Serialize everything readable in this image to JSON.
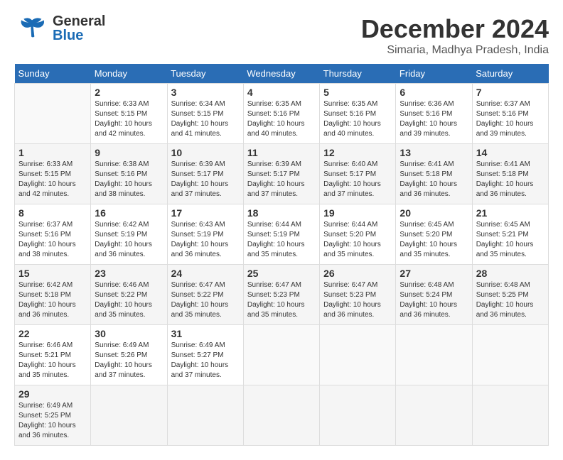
{
  "header": {
    "logo_general": "General",
    "logo_blue": "Blue",
    "month_title": "December 2024",
    "location": "Simaria, Madhya Pradesh, India"
  },
  "calendar": {
    "days_of_week": [
      "Sunday",
      "Monday",
      "Tuesday",
      "Wednesday",
      "Thursday",
      "Friday",
      "Saturday"
    ],
    "weeks": [
      [
        {
          "day": "",
          "info": ""
        },
        {
          "day": "2",
          "info": "Sunrise: 6:33 AM\nSunset: 5:15 PM\nDaylight: 10 hours\nand 42 minutes."
        },
        {
          "day": "3",
          "info": "Sunrise: 6:34 AM\nSunset: 5:15 PM\nDaylight: 10 hours\nand 41 minutes."
        },
        {
          "day": "4",
          "info": "Sunrise: 6:35 AM\nSunset: 5:16 PM\nDaylight: 10 hours\nand 40 minutes."
        },
        {
          "day": "5",
          "info": "Sunrise: 6:35 AM\nSunset: 5:16 PM\nDaylight: 10 hours\nand 40 minutes."
        },
        {
          "day": "6",
          "info": "Sunrise: 6:36 AM\nSunset: 5:16 PM\nDaylight: 10 hours\nand 39 minutes."
        },
        {
          "day": "7",
          "info": "Sunrise: 6:37 AM\nSunset: 5:16 PM\nDaylight: 10 hours\nand 39 minutes."
        }
      ],
      [
        {
          "day": "1",
          "info": "Sunrise: 6:33 AM\nSunset: 5:15 PM\nDaylight: 10 hours\nand 42 minutes."
        },
        {
          "day": "9",
          "info": "Sunrise: 6:38 AM\nSunset: 5:16 PM\nDaylight: 10 hours\nand 38 minutes."
        },
        {
          "day": "10",
          "info": "Sunrise: 6:39 AM\nSunset: 5:17 PM\nDaylight: 10 hours\nand 37 minutes."
        },
        {
          "day": "11",
          "info": "Sunrise: 6:39 AM\nSunset: 5:17 PM\nDaylight: 10 hours\nand 37 minutes."
        },
        {
          "day": "12",
          "info": "Sunrise: 6:40 AM\nSunset: 5:17 PM\nDaylight: 10 hours\nand 37 minutes."
        },
        {
          "day": "13",
          "info": "Sunrise: 6:41 AM\nSunset: 5:18 PM\nDaylight: 10 hours\nand 36 minutes."
        },
        {
          "day": "14",
          "info": "Sunrise: 6:41 AM\nSunset: 5:18 PM\nDaylight: 10 hours\nand 36 minutes."
        }
      ],
      [
        {
          "day": "8",
          "info": "Sunrise: 6:37 AM\nSunset: 5:16 PM\nDaylight: 10 hours\nand 38 minutes."
        },
        {
          "day": "16",
          "info": "Sunrise: 6:42 AM\nSunset: 5:19 PM\nDaylight: 10 hours\nand 36 minutes."
        },
        {
          "day": "17",
          "info": "Sunrise: 6:43 AM\nSunset: 5:19 PM\nDaylight: 10 hours\nand 36 minutes."
        },
        {
          "day": "18",
          "info": "Sunrise: 6:44 AM\nSunset: 5:19 PM\nDaylight: 10 hours\nand 35 minutes."
        },
        {
          "day": "19",
          "info": "Sunrise: 6:44 AM\nSunset: 5:20 PM\nDaylight: 10 hours\nand 35 minutes."
        },
        {
          "day": "20",
          "info": "Sunrise: 6:45 AM\nSunset: 5:20 PM\nDaylight: 10 hours\nand 35 minutes."
        },
        {
          "day": "21",
          "info": "Sunrise: 6:45 AM\nSunset: 5:21 PM\nDaylight: 10 hours\nand 35 minutes."
        }
      ],
      [
        {
          "day": "15",
          "info": "Sunrise: 6:42 AM\nSunset: 5:18 PM\nDaylight: 10 hours\nand 36 minutes."
        },
        {
          "day": "23",
          "info": "Sunrise: 6:46 AM\nSunset: 5:22 PM\nDaylight: 10 hours\nand 35 minutes."
        },
        {
          "day": "24",
          "info": "Sunrise: 6:47 AM\nSunset: 5:22 PM\nDaylight: 10 hours\nand 35 minutes."
        },
        {
          "day": "25",
          "info": "Sunrise: 6:47 AM\nSunset: 5:23 PM\nDaylight: 10 hours\nand 35 minutes."
        },
        {
          "day": "26",
          "info": "Sunrise: 6:47 AM\nSunset: 5:23 PM\nDaylight: 10 hours\nand 36 minutes."
        },
        {
          "day": "27",
          "info": "Sunrise: 6:48 AM\nSunset: 5:24 PM\nDaylight: 10 hours\nand 36 minutes."
        },
        {
          "day": "28",
          "info": "Sunrise: 6:48 AM\nSunset: 5:25 PM\nDaylight: 10 hours\nand 36 minutes."
        }
      ],
      [
        {
          "day": "22",
          "info": "Sunrise: 6:46 AM\nSunset: 5:21 PM\nDaylight: 10 hours\nand 35 minutes."
        },
        {
          "day": "30",
          "info": "Sunrise: 6:49 AM\nSunset: 5:26 PM\nDaylight: 10 hours\nand 37 minutes."
        },
        {
          "day": "31",
          "info": "Sunrise: 6:49 AM\nSunset: 5:27 PM\nDaylight: 10 hours\nand 37 minutes."
        },
        {
          "day": "",
          "info": ""
        },
        {
          "day": "",
          "info": ""
        },
        {
          "day": "",
          "info": ""
        },
        {
          "day": "",
          "info": ""
        }
      ],
      [
        {
          "day": "29",
          "info": "Sunrise: 6:49 AM\nSunset: 5:25 PM\nDaylight: 10 hours\nand 36 minutes."
        },
        {
          "day": "",
          "info": ""
        },
        {
          "day": "",
          "info": ""
        },
        {
          "day": "",
          "info": ""
        },
        {
          "day": "",
          "info": ""
        },
        {
          "day": "",
          "info": ""
        },
        {
          "day": "",
          "info": ""
        }
      ]
    ]
  }
}
